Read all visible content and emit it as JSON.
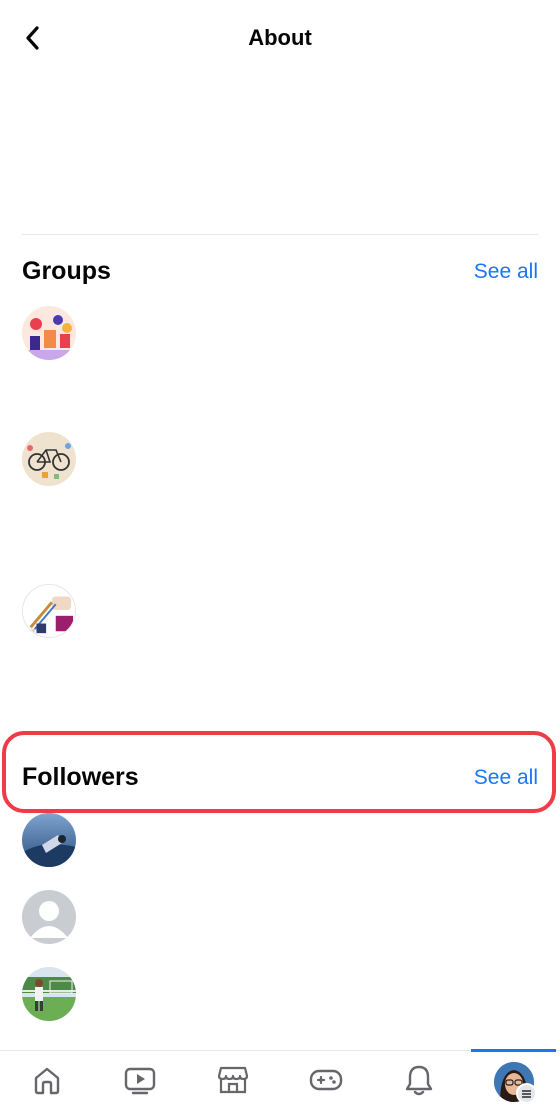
{
  "header": {
    "title": "About",
    "back_icon": "chevron-left-icon"
  },
  "groups": {
    "title": "Groups",
    "see_all": "See all",
    "items": [
      {
        "icon": "group-avatar-1"
      },
      {
        "icon": "group-avatar-2"
      },
      {
        "icon": "group-avatar-3"
      }
    ]
  },
  "followers": {
    "title": "Followers",
    "see_all": "See all",
    "items": [
      {
        "icon": "follower-avatar-1"
      },
      {
        "icon": "follower-avatar-default"
      },
      {
        "icon": "follower-avatar-3"
      }
    ]
  },
  "bottom_nav": {
    "items": [
      {
        "icon": "home-icon"
      },
      {
        "icon": "video-icon"
      },
      {
        "icon": "marketplace-icon"
      },
      {
        "icon": "gaming-icon"
      },
      {
        "icon": "notifications-icon"
      },
      {
        "icon": "profile-avatar"
      }
    ],
    "active_index": 5
  },
  "colors": {
    "accent": "#1877f2",
    "highlight": "#ef3b46",
    "text": "#050505",
    "divider": "#e4e6eb"
  }
}
